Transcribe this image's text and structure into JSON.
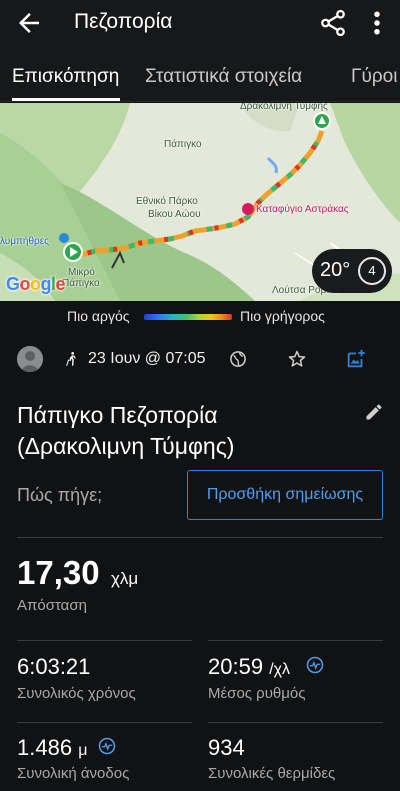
{
  "appbar": {
    "title": "Πεζοπορία"
  },
  "tabs": [
    {
      "label": "Επισκόπηση"
    },
    {
      "label": "Στατιστικά στοιχεία"
    },
    {
      "label": "Γύροι"
    }
  ],
  "map": {
    "labels": {
      "drakolimni": "Δρακόλιμνη Τύμφης",
      "papigko": "Πάπιγκο",
      "park": "Εθνικό Πάρκο",
      "park2": "Βίκου Αώου",
      "refuge": "Καταφύγιο Αστράκας",
      "olympithres": "λυμπήθρες",
      "mikro": "Μικρό",
      "papigko2": "Πάπιγκο",
      "loutsa": "Λούτσα Ρομπο"
    },
    "google_logo": "Google",
    "weather": {
      "temperature": "20°",
      "wind": "4"
    }
  },
  "legend": {
    "slow": "Πιο αργός",
    "fast": "Πιο γρήγορος"
  },
  "activity": {
    "date": "23 Ιουν @ 07:05",
    "title": "Πάπιγκο Πεζοπορία (Δρακολιμνη Τύμφης)",
    "how_prompt": "Πώς πήγε;",
    "add_note": "Προσθήκη σημείωσης"
  },
  "stats": {
    "distance": {
      "value": "17,30",
      "unit": "χλμ",
      "label": "Απόσταση"
    },
    "total_time": {
      "value": "6:03:21",
      "label": "Συνολικός χρόνος"
    },
    "avg_pace": {
      "value": "20:59",
      "unit": "/χλ",
      "label": "Μέσος ρυθμός"
    },
    "total_ascent": {
      "value": "1.486",
      "unit": "μ",
      "label": "Συνολική άνοδος"
    },
    "calories": {
      "value": "934",
      "label": "Συνολικές θερμίδες"
    }
  },
  "colors": {
    "accent": "#2f82d6",
    "background": "#111214"
  }
}
